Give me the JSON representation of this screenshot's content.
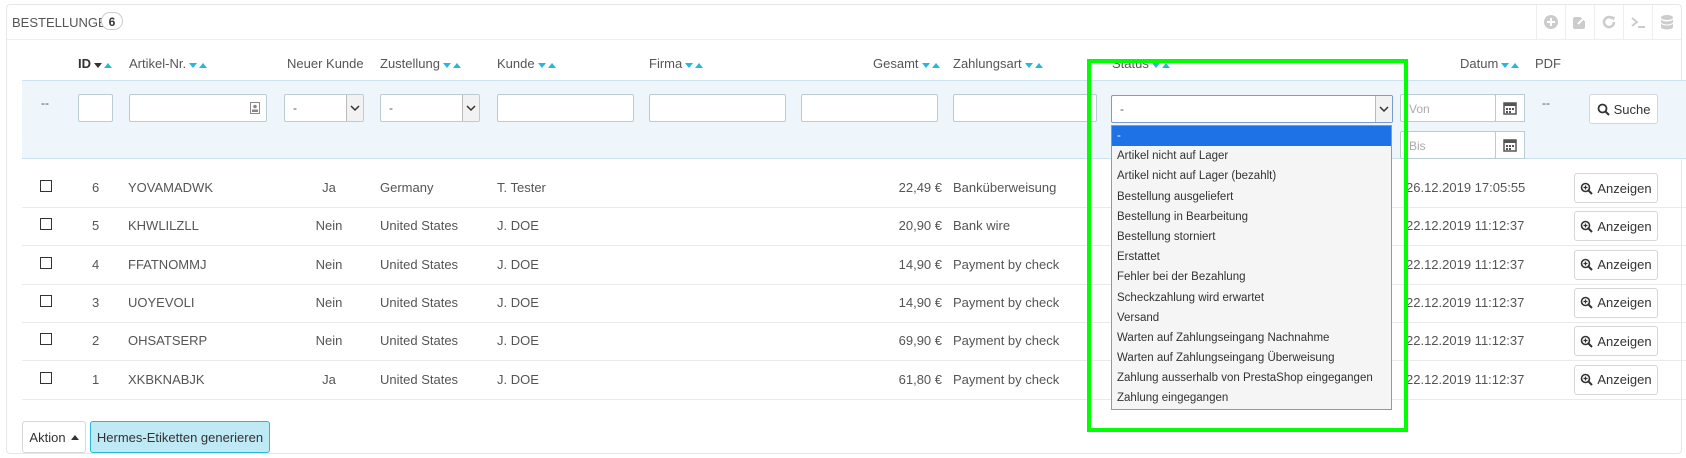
{
  "panel": {
    "title": "BESTELLUNGEN",
    "count": "6",
    "toolbar_icons": [
      "plus-circle-icon",
      "export-icon",
      "refresh-icon",
      "terminal-icon",
      "database-icon"
    ]
  },
  "columns": {
    "id": "ID",
    "reference": "Artikel-Nr.",
    "new_customer": "Neuer Kunde",
    "delivery": "Zustellung",
    "customer": "Kunde",
    "company": "Firma",
    "total": "Gesamt",
    "payment": "Zahlungsart",
    "status": "Status",
    "date": "Datum",
    "pdf": "PDF"
  },
  "filters": {
    "id_placeholder": "--",
    "new_customer_value": "-",
    "delivery_value": "-",
    "status_value": "-",
    "date_from_placeholder": "Von",
    "date_to_placeholder": "Bis",
    "pdf_placeholder": "--",
    "search_button": "Suche"
  },
  "status_options": [
    "-",
    "Artikel nicht auf Lager",
    "Artikel nicht auf Lager (bezahlt)",
    "Bestellung ausgeliefert",
    "Bestellung in Bearbeitung",
    "Bestellung storniert",
    "Erstattet",
    "Fehler bei der Bezahlung",
    "Scheckzahlung wird erwartet",
    "Versand",
    "Warten auf Zahlungseingang Nachnahme",
    "Warten auf Zahlungseingang Überweisung",
    "Zahlung ausserhalb von PrestaShop eingegangen",
    "Zahlung eingegangen"
  ],
  "orders": [
    {
      "id": "6",
      "ref": "YOVAMADWK",
      "new": "Ja",
      "country": "Germany",
      "customer": "T. Tester",
      "total": "22,49 €",
      "payment": "Banküberweisung",
      "date": "26.12.2019 17:05:55",
      "action": "Anzeigen"
    },
    {
      "id": "5",
      "ref": "KHWLILZLL",
      "new": "Nein",
      "country": "United States",
      "customer": "J. DOE",
      "total": "20,90 €",
      "payment": "Bank wire",
      "date": "22.12.2019 11:12:37",
      "action": "Anzeigen"
    },
    {
      "id": "4",
      "ref": "FFATNOMMJ",
      "new": "Nein",
      "country": "United States",
      "customer": "J. DOE",
      "total": "14,90 €",
      "payment": "Payment by check",
      "date": "22.12.2019 11:12:37",
      "action": "Anzeigen"
    },
    {
      "id": "3",
      "ref": "UOYEVOLI",
      "new": "Nein",
      "country": "United States",
      "customer": "J. DOE",
      "total": "14,90 €",
      "payment": "Payment by check",
      "date": "22.12.2019 11:12:37",
      "action": "Anzeigen"
    },
    {
      "id": "2",
      "ref": "OHSATSERP",
      "new": "Nein",
      "country": "United States",
      "customer": "J. DOE",
      "total": "69,90 €",
      "payment": "Payment by check",
      "date": "22.12.2019 11:12:37",
      "action": "Anzeigen"
    },
    {
      "id": "1",
      "ref": "XKBKNABJK",
      "new": "Ja",
      "country": "United States",
      "customer": "J. DOE",
      "total": "61,80 €",
      "payment": "Payment by check",
      "date": "22.12.2019 11:12:37",
      "action": "Anzeigen"
    }
  ],
  "footer": {
    "bulk_action": "Aktion",
    "hermes_button": "Hermes-Etiketten generieren"
  },
  "colors": {
    "accent": "#25b9d7",
    "highlight": "#00ff00",
    "selected_option": "#1e72e6",
    "filter_bg": "#eef6fb",
    "hermes_bg": "#bfe9f5"
  }
}
